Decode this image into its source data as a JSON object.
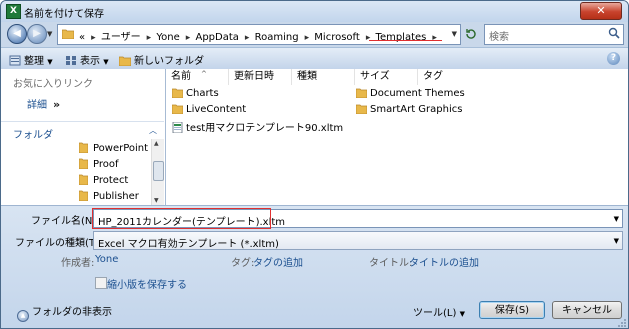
{
  "title": "名前を付けて保存",
  "window": {
    "close_glyph": "✕"
  },
  "address": {
    "crumbs": [
      "«",
      "ユーザー",
      "Yone",
      "AppData",
      "Roaming",
      "Microsoft",
      "Templates"
    ]
  },
  "search": {
    "placeholder": "検索"
  },
  "toolbar": {
    "organize": "整理",
    "view": "表示",
    "new_folder": "新しいフォルダ",
    "help": "?"
  },
  "nav": {
    "favorites_title": "お気に入りリンク",
    "details": "詳細",
    "details_chevron": "»",
    "folders_title": "フォルダ",
    "tree": [
      "PowerPoint",
      "Proof",
      "Protect",
      "Publisher"
    ]
  },
  "columns": [
    "名前",
    "更新日時",
    "種類",
    "サイズ",
    "タグ"
  ],
  "files": [
    {
      "name": "Charts",
      "type": "folder"
    },
    {
      "name": "LiveContent",
      "type": "folder"
    },
    {
      "name": "test用マクロテンプレート90.xltm",
      "type": "file"
    },
    {
      "name": "Document Themes",
      "type": "folder"
    },
    {
      "name": "SmartArt Graphics",
      "type": "folder"
    }
  ],
  "form": {
    "filename_label": "ファイル名(N):",
    "filename_value": "HP_2011カレンダー(テンプレート).xltm",
    "filetype_label": "ファイルの種類(T):",
    "filetype_value": "Excel マクロ有効テンプレート (*.xltm)",
    "author_label": "作成者:",
    "author_value": "Yone",
    "tags_label": "タグ:",
    "tags_value": "タグの追加",
    "title_label": "タイトル:",
    "title_value": "タイトルの追加",
    "thumbnail_label": "縮小版を保存する"
  },
  "footer": {
    "hide_folders": "フォルダの非表示",
    "tools": "ツール(L)",
    "save": "保存(S)",
    "cancel": "キャンセル"
  },
  "colors": {
    "accent_red": "#e03030",
    "link_blue": "#1b4f8f",
    "folder_yellow": "#e8b84a"
  }
}
